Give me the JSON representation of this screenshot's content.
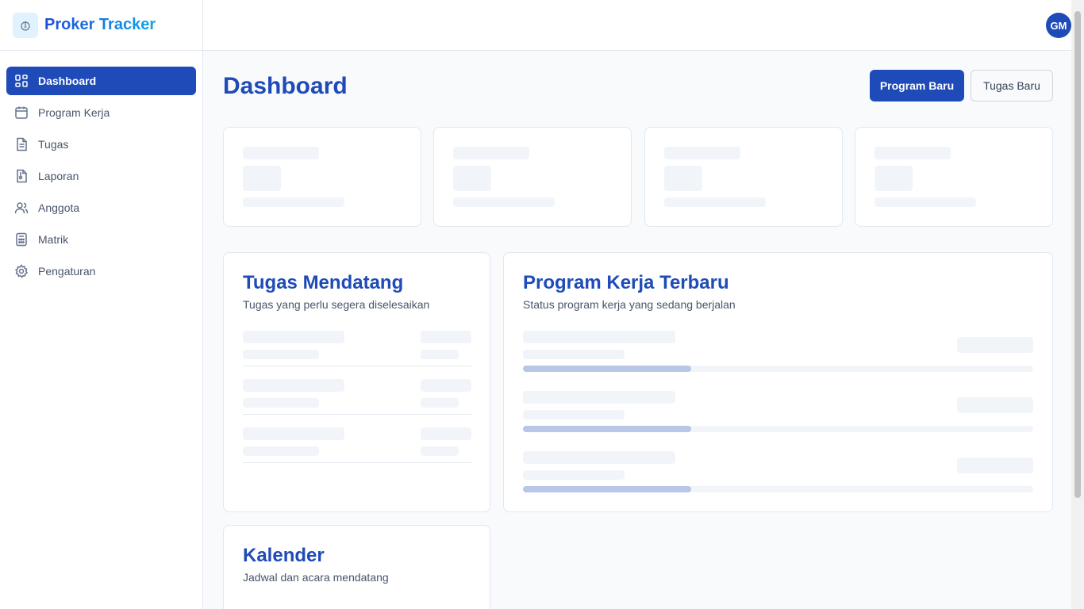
{
  "app": {
    "name": "Proker Tracker"
  },
  "user": {
    "initials": "GM"
  },
  "sidebar": {
    "items": [
      {
        "label": "Dashboard",
        "icon": "dashboard-icon",
        "active": true
      },
      {
        "label": "Program Kerja",
        "icon": "calendar-icon",
        "active": false
      },
      {
        "label": "Tugas",
        "icon": "document-icon",
        "active": false
      },
      {
        "label": "Laporan",
        "icon": "report-icon",
        "active": false
      },
      {
        "label": "Anggota",
        "icon": "users-icon",
        "active": false
      },
      {
        "label": "Matrik",
        "icon": "calculator-icon",
        "active": false
      },
      {
        "label": "Pengaturan",
        "icon": "gear-icon",
        "active": false
      }
    ]
  },
  "header": {
    "title": "Dashboard",
    "primary_button": "Program Baru",
    "secondary_button": "Tugas Baru"
  },
  "upcoming_tasks": {
    "title": "Tugas Mendatang",
    "subtitle": "Tugas yang perlu segera diselesaikan"
  },
  "latest_programs": {
    "title": "Program Kerja Terbaru",
    "subtitle": "Status program kerja yang sedang berjalan",
    "progress": [
      0.33,
      0.33,
      0.33
    ]
  },
  "calendar": {
    "title": "Kalender",
    "subtitle": "Jadwal dan acara mendatang"
  },
  "colors": {
    "primary": "#1e4bb8",
    "skeleton": "#f1f5f9",
    "progress": "#b8c6e8"
  }
}
